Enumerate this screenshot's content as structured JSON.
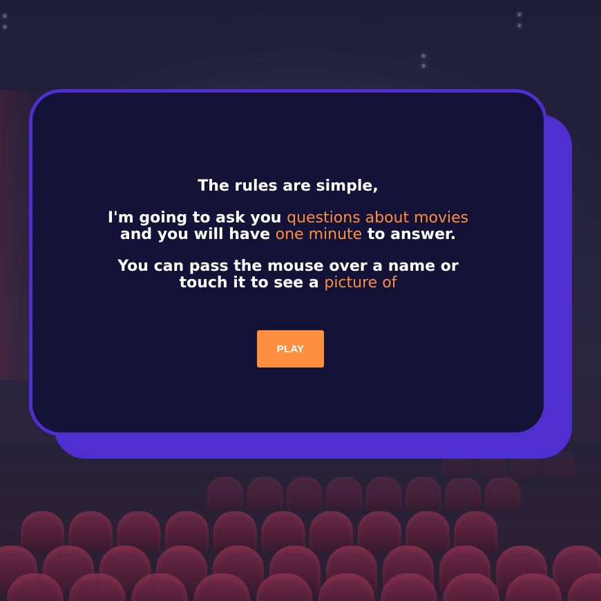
{
  "modal": {
    "line1": "The rules are simple,",
    "para2": {
      "pre": "I'm going to ask you ",
      "highlight1": "questions about movies",
      "mid": "and you will have ",
      "highlight2": "one minute",
      "post": " to answer."
    },
    "para3": {
      "pre": "You can pass the mouse over a name or",
      "pre2": "touch it to see a ",
      "highlight": "picture of"
    },
    "play_label": "PLAY"
  },
  "colors": {
    "accent": "#fc9040",
    "card_border": "#4f2fcf",
    "card_bg": "#141337",
    "text": "#ffffff"
  }
}
